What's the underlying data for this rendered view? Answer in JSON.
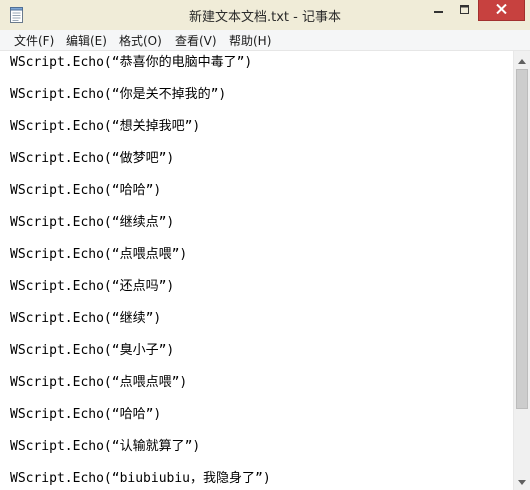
{
  "window": {
    "title": "新建文本文档.txt - 记事本",
    "close_icon": "close-icon",
    "minimize_icon": "minimize-icon",
    "maximize_icon": "maximize-icon"
  },
  "menu": {
    "items": [
      {
        "label": "文件(F)"
      },
      {
        "label": "编辑(E)"
      },
      {
        "label": "格式(O)"
      },
      {
        "label": "查看(V)"
      },
      {
        "label": "帮助(H)"
      }
    ]
  },
  "editor": {
    "lines": [
      "WScript.Echo(“恭喜你的电脑中毒了”)",
      "WScript.Echo(“你是关不掉我的”)",
      "WScript.Echo(“想关掉我吧”)",
      "WScript.Echo(“做梦吧”)",
      "WScript.Echo(“哈哈”)",
      "WScript.Echo(“继续点”)",
      "WScript.Echo(“点喂点喂”)",
      "WScript.Echo(“还点吗”)",
      "WScript.Echo(“继续”)",
      "WScript.Echo(“臭小子”)",
      "WScript.Echo(“点喂点喂”)",
      "WScript.Echo(“哈哈”)",
      "WScript.Echo(“认输就算了”)",
      "WScript.Echo(“biubiubiu，我隐身了”)"
    ]
  },
  "colors": {
    "titlebar": "#f0ecd8",
    "close_button": "#c7413f",
    "text": "#000000"
  }
}
